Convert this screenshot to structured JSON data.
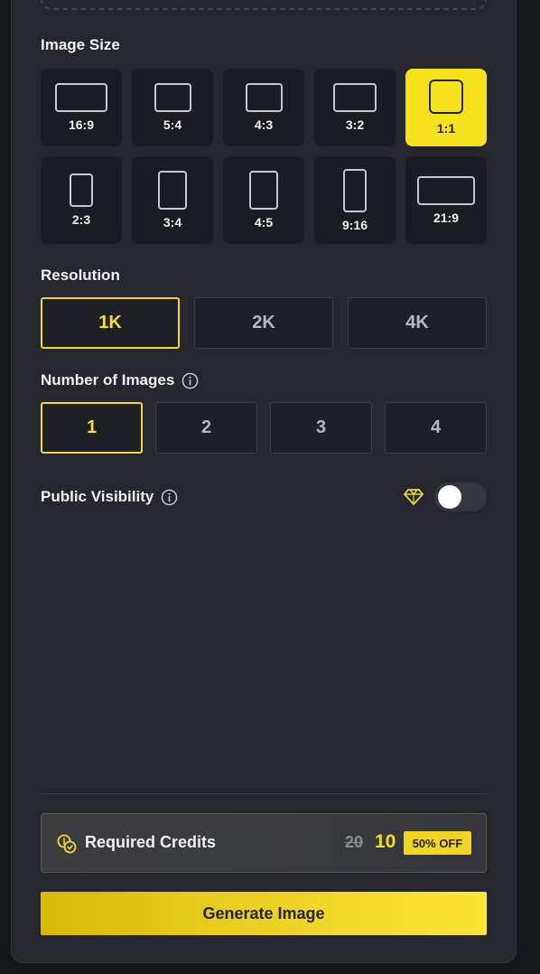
{
  "image_size": {
    "label": "Image Size",
    "options": [
      {
        "label": "16:9",
        "selected": false
      },
      {
        "label": "5:4",
        "selected": false
      },
      {
        "label": "4:3",
        "selected": false
      },
      {
        "label": "3:2",
        "selected": false
      },
      {
        "label": "1:1",
        "selected": true
      },
      {
        "label": "2:3",
        "selected": false
      },
      {
        "label": "3:4",
        "selected": false
      },
      {
        "label": "4:5",
        "selected": false
      },
      {
        "label": "9:16",
        "selected": false
      },
      {
        "label": "21:9",
        "selected": false
      }
    ]
  },
  "resolution": {
    "label": "Resolution",
    "options": [
      {
        "label": "1K",
        "selected": true
      },
      {
        "label": "2K",
        "selected": false
      },
      {
        "label": "4K",
        "selected": false
      }
    ]
  },
  "number_of_images": {
    "label": "Number of Images",
    "icon": "info-icon",
    "options": [
      {
        "label": "1",
        "selected": true
      },
      {
        "label": "2",
        "selected": false
      },
      {
        "label": "3",
        "selected": false
      },
      {
        "label": "4",
        "selected": false
      }
    ]
  },
  "public_visibility": {
    "label": "Public Visibility",
    "icon": "info-icon",
    "premium_icon": "diamond-icon",
    "enabled": false
  },
  "credits": {
    "label": "Required Credits",
    "icon": "coins-icon",
    "old_price": "20",
    "new_price": "10",
    "discount": "50% OFF"
  },
  "generate_button": {
    "label": "Generate Image"
  },
  "colors": {
    "accent": "#f5e11c",
    "panel": "#25262e",
    "background": "#16171b",
    "tile": "#1b1c21"
  }
}
